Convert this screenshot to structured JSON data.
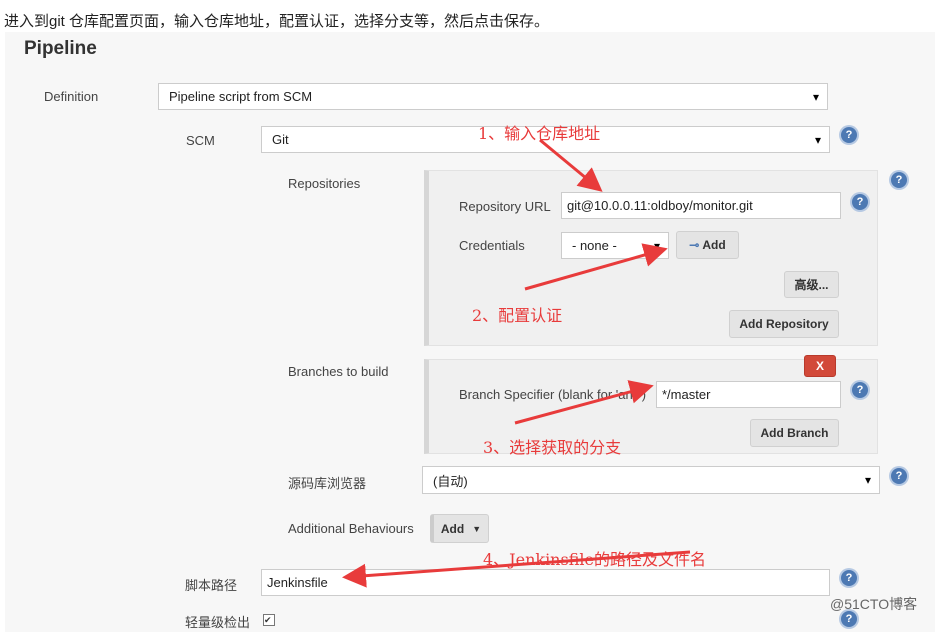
{
  "intro": "进入到git 仓库配置页面，输入仓库地址，配置认证，选择分支等，然后点击保存。",
  "section_title": "Pipeline",
  "definition": {
    "label": "Definition",
    "value": "Pipeline script from SCM"
  },
  "scm": {
    "label": "SCM",
    "value": "Git"
  },
  "repositories": {
    "label": "Repositories",
    "url_label": "Repository URL",
    "url_value": "git@10.0.0.11:oldboy/monitor.git",
    "cred_label": "Credentials",
    "cred_value": "- none -",
    "add_label": "Add",
    "advanced_label": "高级...",
    "add_repo_label": "Add Repository"
  },
  "branches": {
    "label": "Branches to build",
    "delete_label": "X",
    "spec_label": "Branch Specifier (blank for 'any')",
    "spec_value": "*/master",
    "add_branch_label": "Add Branch"
  },
  "browser": {
    "label": "源码库浏览器",
    "value": "(自动)"
  },
  "behaviours": {
    "label": "Additional Behaviours",
    "add_label": "Add"
  },
  "script_path": {
    "label": "脚本路径",
    "value": "Jenkinsfile"
  },
  "lightweight": {
    "label": "轻量级检出",
    "checked": true
  },
  "annotations": [
    "1、输入仓库地址",
    "2、配置认证",
    "3、选择获取的分支",
    "4、Jenkinsfile的路径及文件名"
  ],
  "annotation_color": "#e83b3b",
  "watermark": "@51CTO博客"
}
